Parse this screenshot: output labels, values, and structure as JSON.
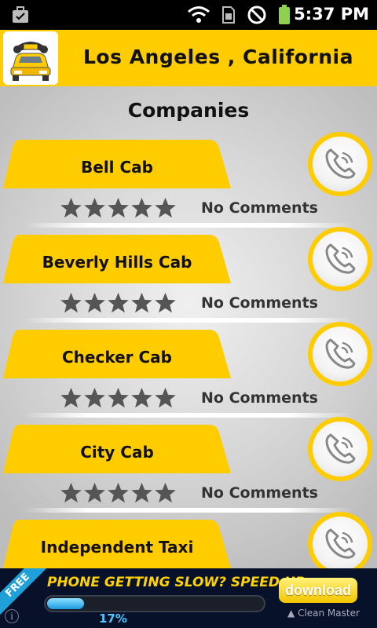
{
  "status_bar": {
    "time": "5:37 PM",
    "icons": [
      "briefcase-icon",
      "wifi-icon",
      "sim-icon",
      "do-not-disturb-icon",
      "battery-icon"
    ]
  },
  "header": {
    "logo_icon": "taxi-phone-logo",
    "title": "Los Angeles , California",
    "background": "#ffcc00"
  },
  "main": {
    "section_title": "Companies",
    "companies": [
      {
        "name": "Bell Cab",
        "rating": 0,
        "comments": "No Comments"
      },
      {
        "name": "Beverly Hills Cab",
        "rating": 0,
        "comments": "No Comments"
      },
      {
        "name": "Checker Cab",
        "rating": 0,
        "comments": "No Comments"
      },
      {
        "name": "City Cab",
        "rating": 0,
        "comments": "No Comments"
      },
      {
        "name": "Independent Taxi",
        "rating": 0,
        "comments": ""
      }
    ],
    "accent": "#ffcc00",
    "star_color": "#555555"
  },
  "ad": {
    "ribbon": "FREE",
    "headline": "PHONE GETTING SLOW? SPEED UP",
    "progress": 0.17,
    "progress_label": "17%",
    "button": "download",
    "brand": "Clean Master",
    "info": "i"
  }
}
